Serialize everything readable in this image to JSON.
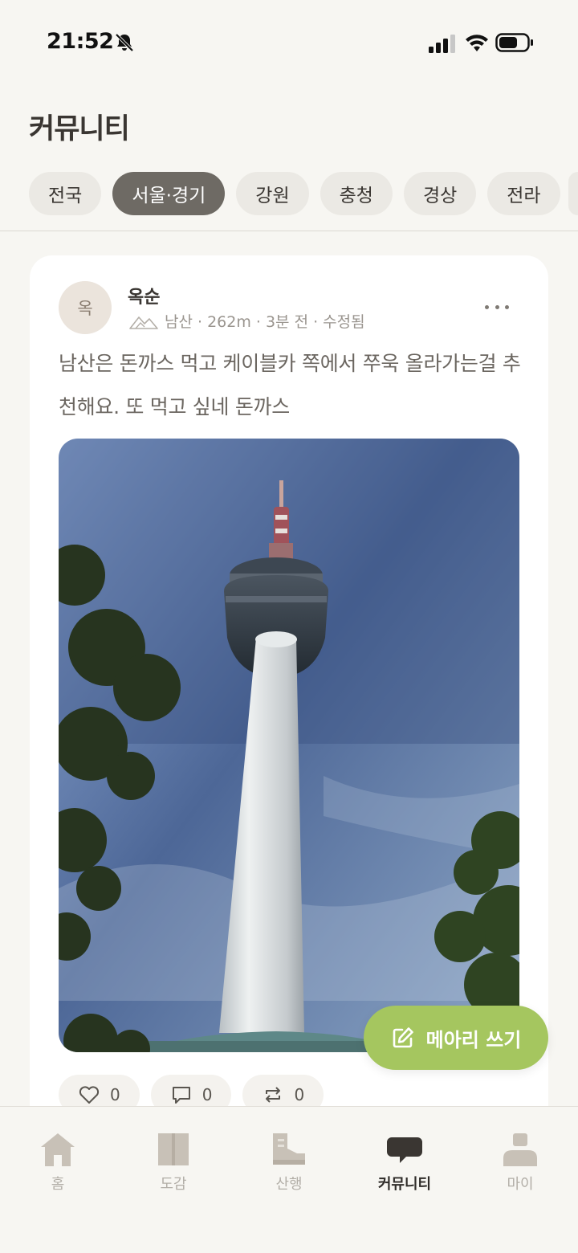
{
  "status_bar": {
    "time": "21:52",
    "icons": [
      "bell-slash-icon",
      "signal-icon",
      "wifi-icon",
      "battery-icon"
    ]
  },
  "header": {
    "title": "커뮤니티"
  },
  "regions": {
    "items": [
      "전국",
      "서울·경기",
      "강원",
      "충청",
      "경상",
      "전라"
    ],
    "selected": "서울·경기"
  },
  "post": {
    "avatar_initial": "옥",
    "author": "옥순",
    "meta": "남산 · 262m · 3분 전 · 수정됨",
    "body": "남산은 돈까스 먹고 케이블카 쪽에서 쭈욱 올라가는걸 추천해요. 또 먹고 싶네 돈까스",
    "photo_subject": "namsan-tower-photo",
    "likes": "0",
    "comments": "0",
    "reposts": "0"
  },
  "fab": {
    "label": "메아리 쓰기"
  },
  "bottom_nav": {
    "items": [
      {
        "label": "홈",
        "icon": "home-icon"
      },
      {
        "label": "도감",
        "icon": "book-icon"
      },
      {
        "label": "산행",
        "icon": "hiking-boot-icon"
      },
      {
        "label": "커뮤니티",
        "icon": "chat-bubble-icon"
      },
      {
        "label": "마이",
        "icon": "person-icon"
      }
    ],
    "active": "커뮤니티"
  },
  "colors": {
    "background": "#f7f6f2",
    "active_chip": "#6e6a64",
    "fab": "#a5c65f",
    "card": "#ffffff"
  }
}
